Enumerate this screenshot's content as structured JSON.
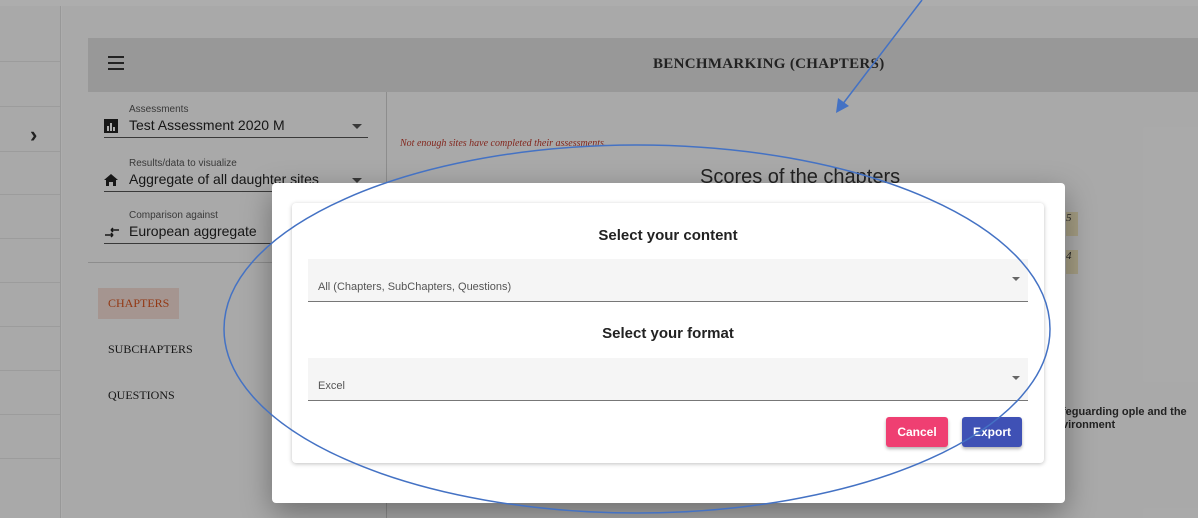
{
  "header": {
    "title": "BENCHMARKING (CHAPTERS)"
  },
  "filters": {
    "assessments": {
      "label": "Assessments",
      "value": "Test Assessment 2020 M"
    },
    "results": {
      "label": "Results/data to visualize",
      "value": "Aggregate of all daughter sites"
    },
    "comparison": {
      "label": "Comparison against",
      "value": "European aggregate"
    }
  },
  "nav": {
    "chapters": "CHAPTERS",
    "subchapters": "SUBCHAPTERS",
    "questions": "QUESTIONS"
  },
  "main": {
    "warning": "Not enough sites have completed their assessments.",
    "chart_title": "Scores of the chapters",
    "legend_values": [
      "5",
      "4"
    ],
    "side_label": "feguarding ople and the vironment"
  },
  "dialog": {
    "content_title": "Select your content",
    "content_value": "All (Chapters, SubChapters, Questions)",
    "format_title": "Select your format",
    "format_value": "Excel",
    "cancel_label": "Cancel",
    "export_label": "Export"
  },
  "colors": {
    "primary": "#3f51b5",
    "accent": "#ef3f72",
    "active_nav": "#d9531e",
    "warning": "#c0392b",
    "annotation": "#4472c4"
  }
}
